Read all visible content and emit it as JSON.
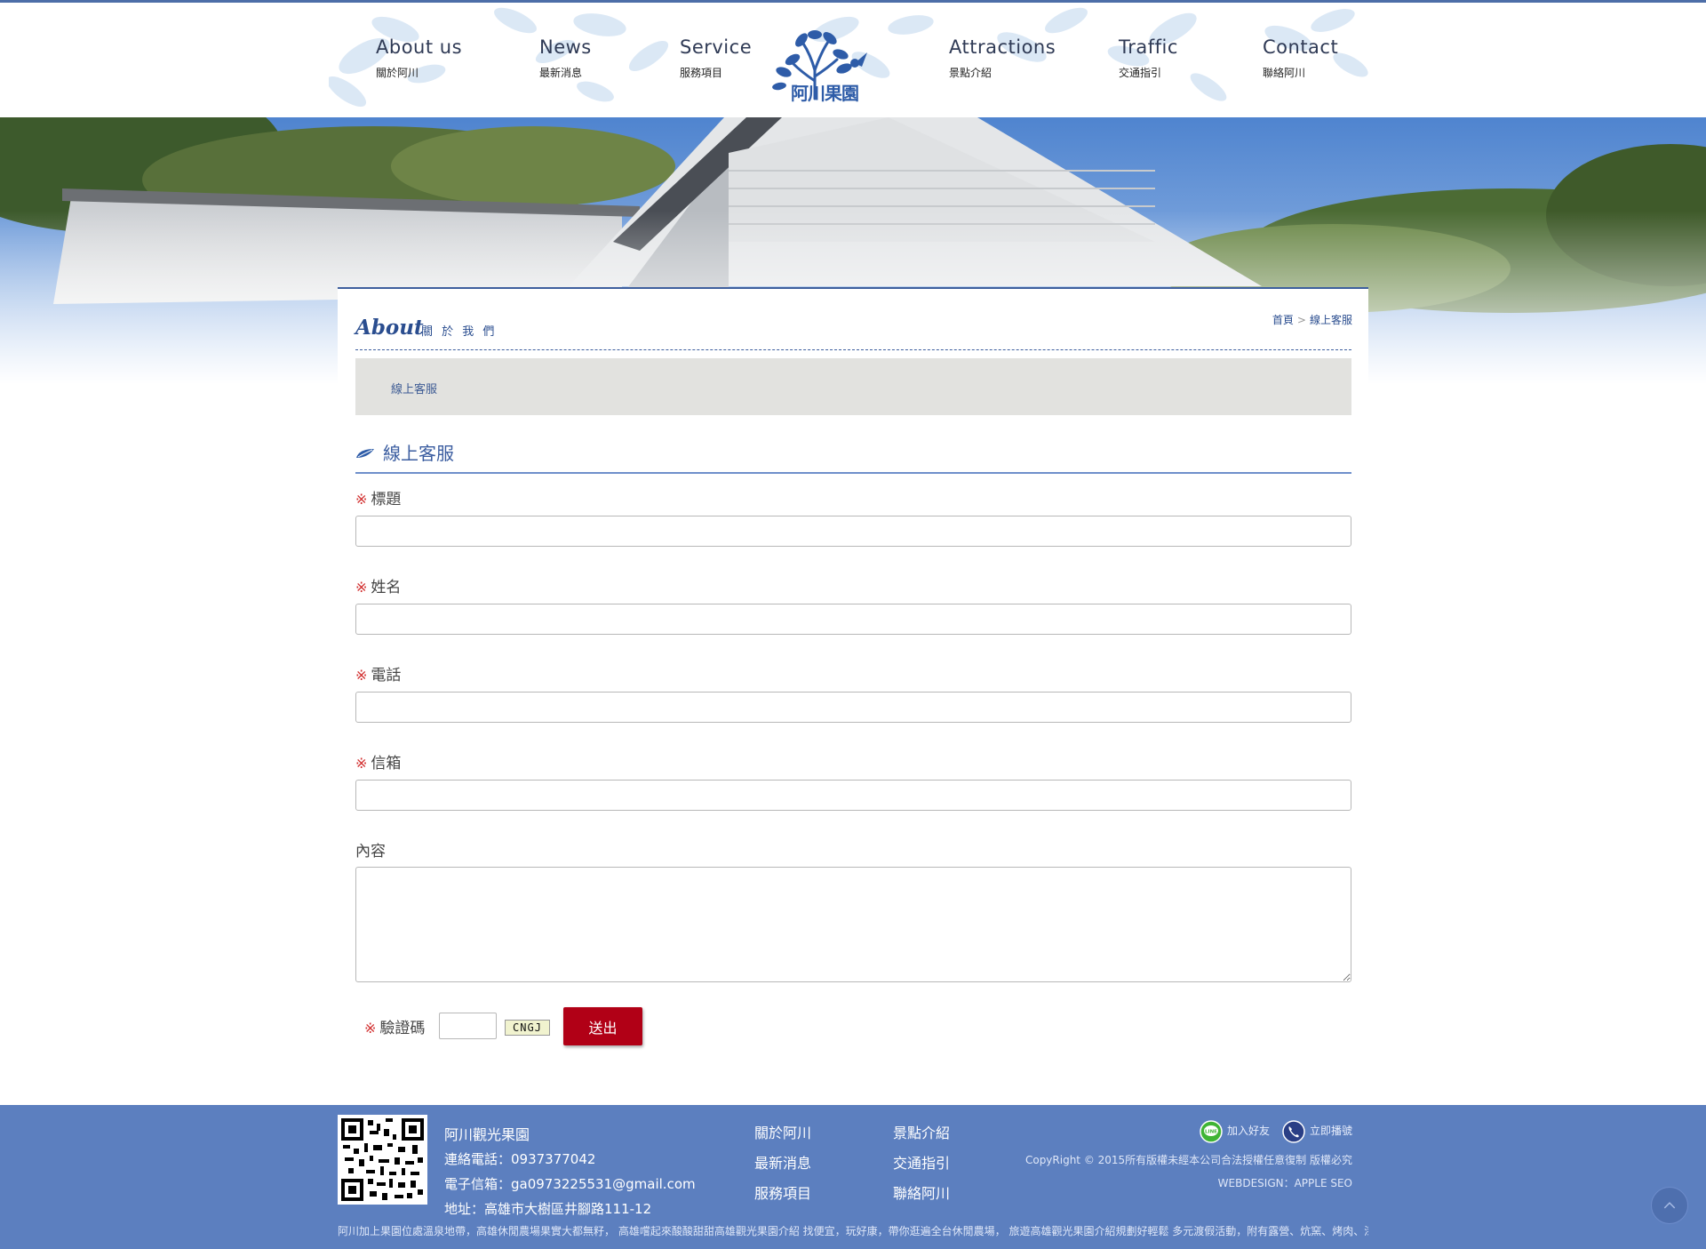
{
  "nav": {
    "items": [
      {
        "en": "About us",
        "zh": "關於阿川"
      },
      {
        "en": "News",
        "zh": "最新消息"
      },
      {
        "en": "Service",
        "zh": "服務項目"
      },
      {
        "en": "Attractions",
        "zh": "景點介紹"
      },
      {
        "en": "Traffic",
        "zh": "交通指引"
      },
      {
        "en": "Contact",
        "zh": "聯絡阿川"
      }
    ],
    "logo_text": "阿川果園"
  },
  "colors": {
    "accent": "#3e5f9e",
    "footer_bg": "#5c7fbf",
    "submit_bg": "#b10016",
    "required_mark": "#d23030"
  },
  "page": {
    "section_en": "About",
    "section_zh": "關 於 我 們",
    "breadcrumb": {
      "home": "首頁",
      "separator": ">",
      "current": "線上客服"
    },
    "subnav_item": "線上客服",
    "form_title": "線上客服"
  },
  "form": {
    "required_mark": "※",
    "fields": [
      {
        "label": "標題",
        "value": ""
      },
      {
        "label": "姓名",
        "value": ""
      },
      {
        "label": "電話",
        "value": ""
      },
      {
        "label": "信箱",
        "value": ""
      }
    ],
    "content_label": "內容",
    "captcha_label": "驗證碼",
    "captcha_code": "CNGJ",
    "submit_label": "送出"
  },
  "footer": {
    "name": "阿川觀光果園",
    "phone": "連絡電話：0937377042",
    "email": "電子信箱：ga0973225531@gmail.com",
    "address": "地址：高雄市大樹區井腳路111-12",
    "links_col1": [
      "關於阿川",
      "最新消息",
      "服務項目"
    ],
    "links_col2": [
      "景點介紹",
      "交通指引",
      "聯絡阿川"
    ],
    "line_label": "加入好友",
    "call_label": "立即播號",
    "copyright": "CopyRight © 2015所有版權未經本公司合法授權任意復制 版權必究",
    "webdesign": "WEBDESIGN：APPLE SEO",
    "marquee": "阿川加上果園位處溫泉地帶，高雄休閒農場果實大都無籽， 高雄嚐起來酸酸甜甜高雄觀光果園介紹 找便宜，玩好康，帶你逛遍全台休閒農場， 旅遊高雄觀光果園介紹規劃好輕鬆 多元渡假活動，附有露營、炕窯、烤肉、漆彈"
  }
}
